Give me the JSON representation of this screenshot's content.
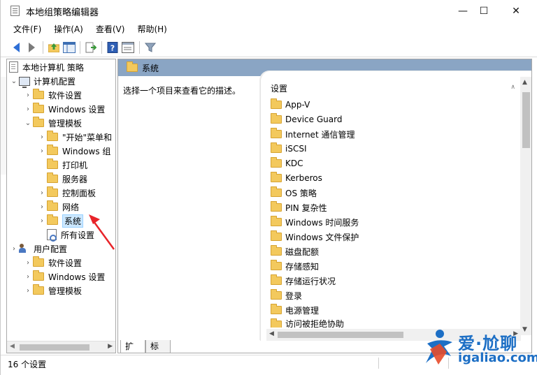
{
  "window": {
    "title": "本地组策略编辑器",
    "minimize": "—",
    "maximize": "☐",
    "close": "✕"
  },
  "menu": [
    "文件(F)",
    "操作(A)",
    "查看(V)",
    "帮助(H)"
  ],
  "toolbar": {
    "icons": [
      "back-arrow-icon",
      "forward-arrow-icon",
      "up-folder-icon",
      "show-hide-tree-icon",
      "export-list-icon",
      "help-icon",
      "properties-icon",
      "filter-icon"
    ]
  },
  "tree": {
    "root": "本地计算机 策略",
    "computer_config": "计算机配置",
    "items": {
      "software_settings": "软件设置",
      "windows_settings": "Windows 设置",
      "admin_templates": "管理模板",
      "start_menu": "\"开始\"菜单和",
      "windows_components": "Windows 组",
      "printers": "打印机",
      "server": "服务器",
      "control_panel": "控制面板",
      "network": "网络",
      "system": "系统",
      "all_settings": "所有设置"
    },
    "user_config": "用户配置",
    "user_items": {
      "software_settings": "软件设置",
      "windows_settings": "Windows 设置",
      "admin_templates": "管理模板"
    }
  },
  "right": {
    "header": "系统",
    "description": "选择一个项目来查看它的描述。",
    "list_header": "设置",
    "items": [
      "App-V",
      "Device Guard",
      "Internet 通信管理",
      "iSCSI",
      "KDC",
      "Kerberos",
      "OS 策略",
      "PIN 复杂性",
      "Windows 时间服务",
      "Windows 文件保护",
      "磁盘配额",
      "存储感知",
      "存储运行状况",
      "登录",
      "电源管理",
      "访问被拒绝协助"
    ]
  },
  "tabs": [
    "扩展",
    "标准"
  ],
  "status": "16 个设置",
  "watermark": {
    "line1": "爱·尬聊",
    "line2": "igaliao.com"
  },
  "colors": {
    "header_bar": "#8aa5c4",
    "selection": "#cce8ff",
    "folder": "#f3c95d",
    "annotation": "#e8242a",
    "watermark": "#1d6fc5"
  }
}
